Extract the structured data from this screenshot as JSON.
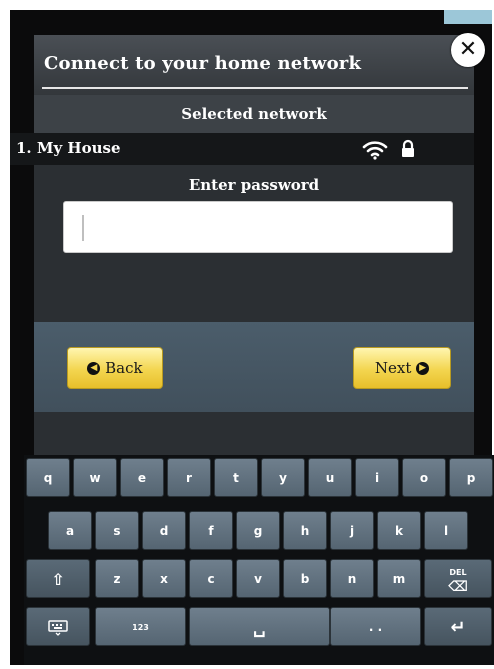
{
  "dialog": {
    "title": "Connect to your home network",
    "selected_label": "Selected network",
    "network": {
      "name": "1. My House",
      "icons": [
        "wifi-icon",
        "lock-icon"
      ]
    },
    "password_label": "Enter password",
    "password_value": "",
    "back_label": "Back",
    "next_label": "Next",
    "close_glyph": "✕"
  },
  "keyboard": {
    "row1": [
      "q",
      "w",
      "e",
      "r",
      "t",
      "y",
      "u",
      "i",
      "o",
      "p"
    ],
    "row2": [
      "a",
      "s",
      "d",
      "f",
      "g",
      "h",
      "j",
      "k",
      "l"
    ],
    "row3": [
      "z",
      "x",
      "c",
      "v",
      "b",
      "n",
      "m"
    ],
    "shift_glyph": "⇧",
    "del_label": "DEL",
    "keyboard_icon": "keyboard-icon",
    "numbers_label": "123",
    "space_glyph": "␣",
    "dots_label": ". .",
    "enter_glyph": "↵"
  },
  "colors": {
    "button_yellow": "#f3d54f",
    "panel_bg": "#2b2f33",
    "key_bg": "#5f6f7c"
  }
}
